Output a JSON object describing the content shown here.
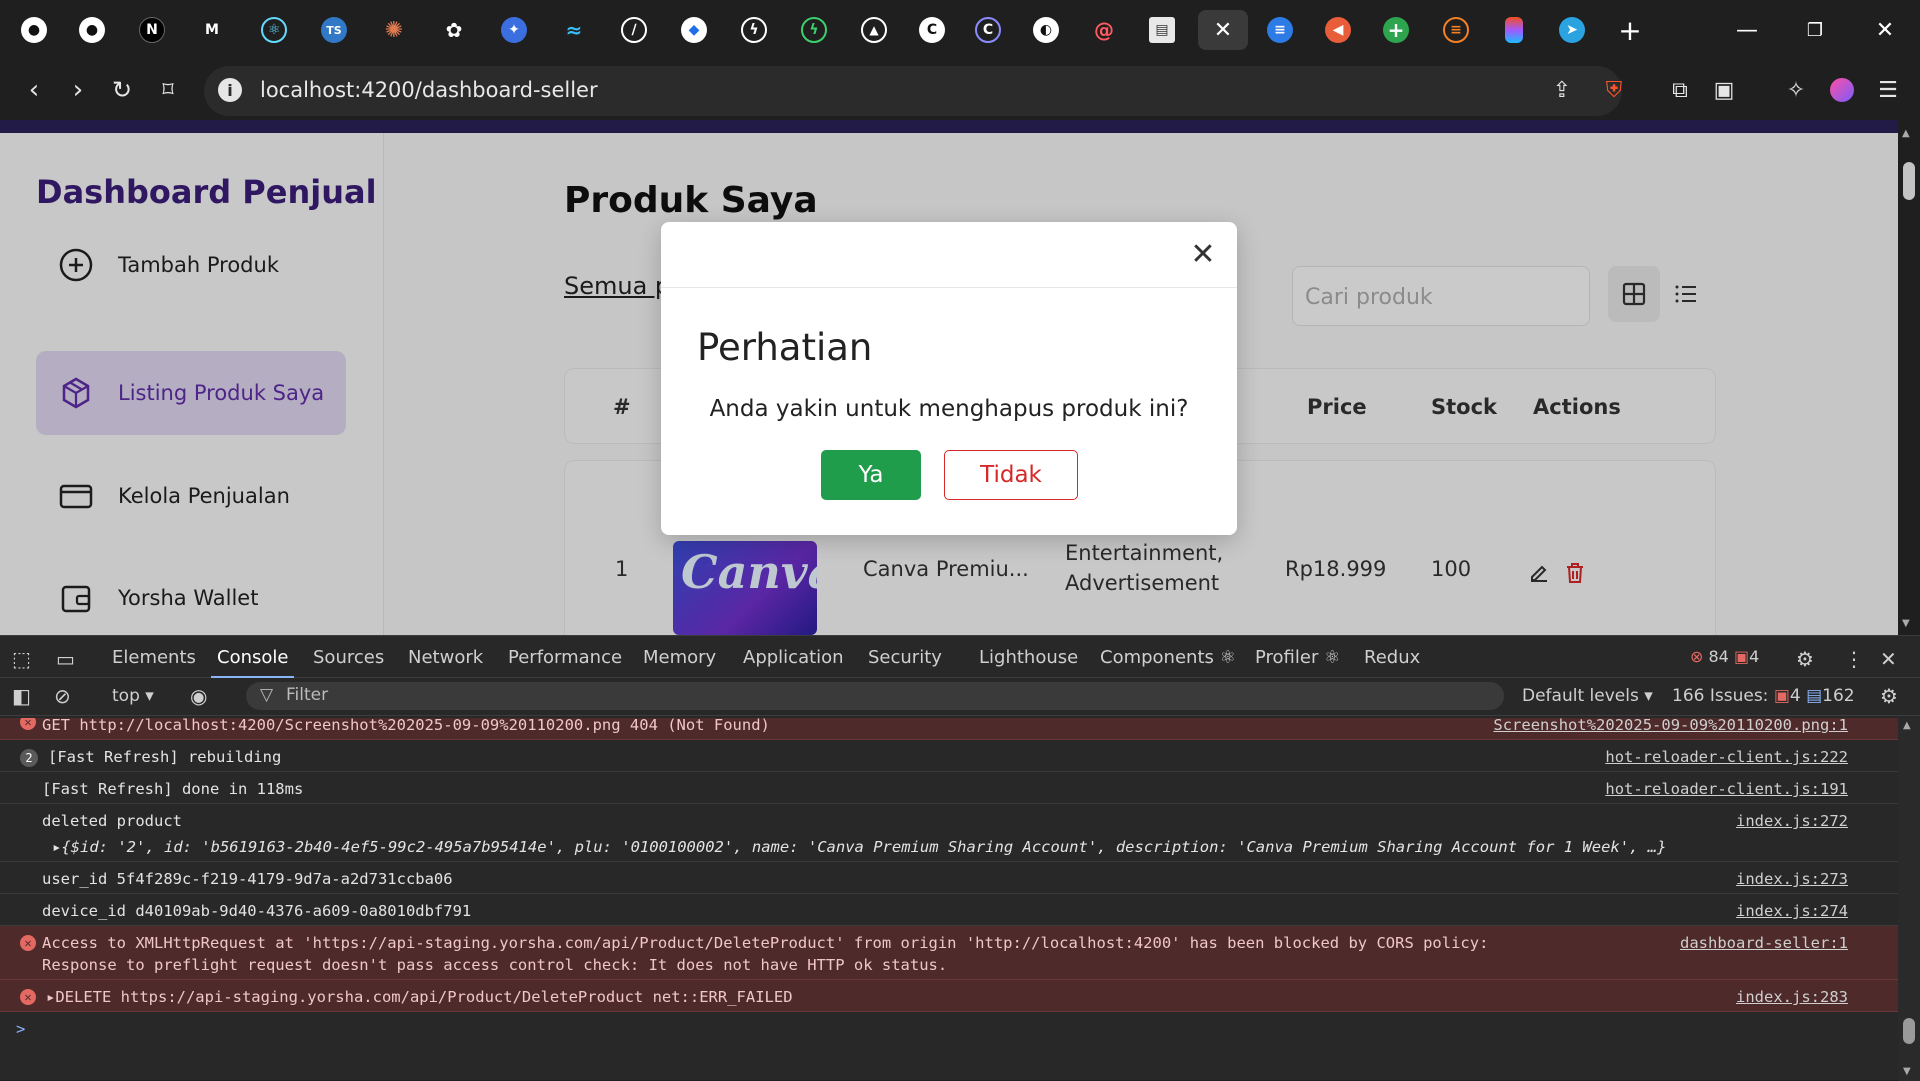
{
  "browser": {
    "url": "localhost:4200/dashboard-seller",
    "tab_icons": [
      "github-icon",
      "github-icon",
      "notion-icon",
      "medium-icon",
      "react-icon",
      "typescript-icon",
      "claude-icon",
      "chatgpt-icon",
      "gemini-icon",
      "tailwind-icon",
      "pen-icon",
      "shield-icon",
      "bolt-icon",
      "bolt-green-icon",
      "vercel-icon",
      "copilot-icon",
      "copilot-outline-icon",
      "circle-icon",
      "swirl-icon",
      "docs-icon",
      "close-icon",
      "list-icon",
      "cursor-icon",
      "plus-icon",
      "stack-icon",
      "figma-icon",
      "telegram-icon"
    ],
    "new_tab": "+"
  },
  "sidebar": {
    "brand": "Dashboard Penjual",
    "items": [
      {
        "label": "Tambah Produk",
        "icon": "plus-circle-icon"
      },
      {
        "label": "Listing Produk Saya",
        "icon": "box-icon"
      },
      {
        "label": "Kelola Penjualan",
        "icon": "card-icon"
      },
      {
        "label": "Yorsha Wallet",
        "icon": "wallet-icon"
      }
    ]
  },
  "main": {
    "title": "Produk Saya",
    "filter_link": "Semua pr",
    "search_placeholder": "Cari produk",
    "table": {
      "headers": {
        "num": "#",
        "price": "Price",
        "stock": "Stock",
        "actions": "Actions"
      },
      "row": {
        "num": "1",
        "thumb_text": "Canva",
        "name": "Canva Premiu...",
        "category_line1": "Entertainment,",
        "category_line2": "Advertisement",
        "price": "Rp18.999",
        "stock": "100"
      }
    }
  },
  "modal": {
    "title": "Perhatian",
    "message": "Anda yakin untuk menghapus produk ini?",
    "yes": "Ya",
    "no": "Tidak"
  },
  "devtools": {
    "tabs": [
      "Elements",
      "Console",
      "Sources",
      "Network",
      "Performance",
      "Memory",
      "Application",
      "Security",
      "Lighthouse",
      "Components ⚛",
      "Profiler ⚛",
      "Redux"
    ],
    "active_tab": "Console",
    "errors": "84",
    "warnings": "4",
    "context": "top",
    "filter_placeholder": "Filter",
    "levels": "Default levels",
    "issues_label": "166 Issues:",
    "issues_warn": "4",
    "issues_info": "162",
    "logs": {
      "l0_text": "GET http://localhost:4200/Screenshot%202025-09-09%20110200.png 404 (Not Found)",
      "l0_src": "Screenshot%202025-09-09%20110200.png:1",
      "l1_count": "2",
      "l1_text": "[Fast Refresh] rebuilding",
      "l1_src": "hot-reloader-client.js:222",
      "l2_text": "[Fast Refresh] done in 118ms",
      "l2_src": "hot-reloader-client.js:191",
      "l3_text": "deleted product",
      "l3_src": "index.js:272",
      "l3_obj": "▸{$id: '2', id: 'b5619163-2b40-4ef5-99c2-495a7b95414e', plu: '0100100002', name: 'Canva Premium Sharing Account', description: 'Canva Premium Sharing Account for 1 Week', …}",
      "l4_text": "user_id 5f4f289c-f219-4179-9d7a-a2d731ccba06",
      "l4_src": "index.js:273",
      "l5_text": "device_id d40109ab-9d40-4376-a609-0a8010dbf791",
      "l5_src": "index.js:274",
      "l6_text1": "Access to XMLHttpRequest at 'https://api-staging.yorsha.com/api/Product/DeleteProduct' from origin 'http://localhost:4200' has been blocked by CORS policy:",
      "l6_text2": "Response to preflight request doesn't pass access control check: It does not have HTTP ok status.",
      "l6_src": "dashboard-seller:1",
      "l7_text": "▸DELETE https://api-staging.yorsha.com/api/Product/DeleteProduct net::ERR_FAILED",
      "l7_src": "index.js:283",
      "prompt": ">"
    }
  }
}
